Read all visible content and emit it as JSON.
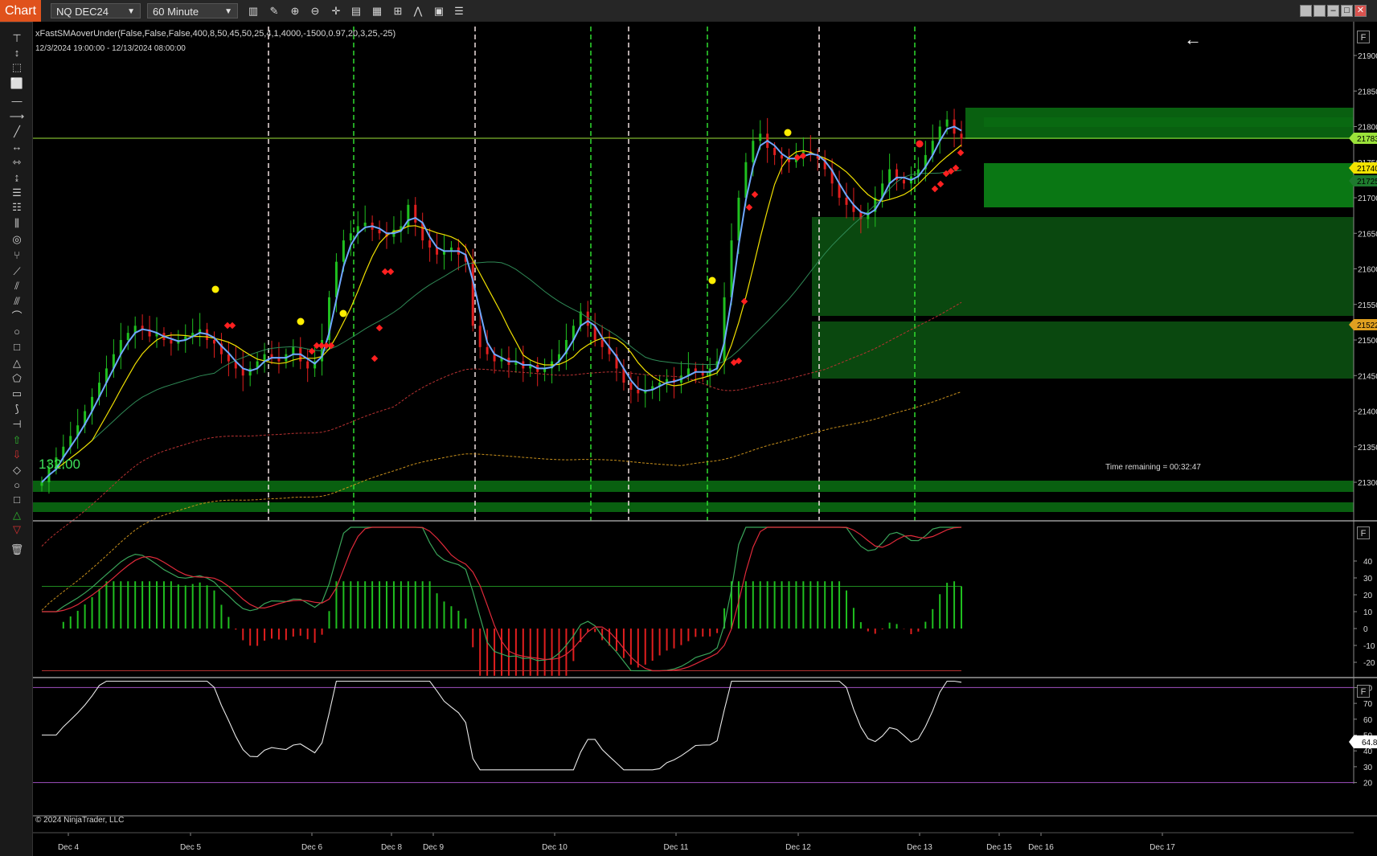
{
  "toolbar": {
    "chart_tab": "Chart",
    "instrument": "NQ DEC24",
    "interval": "60 Minute",
    "icons": [
      "bar-type-icon",
      "draw-tool-icon",
      "zoom-in-icon",
      "zoom-out-icon",
      "crosshair-icon",
      "data-box-icon",
      "properties-icon",
      "indicators-icon",
      "strategies-icon",
      "more-icon"
    ]
  },
  "window_controls": [
    "tile-icon",
    "tile2-icon",
    "minimize-icon",
    "maximize-icon",
    "close-icon"
  ],
  "left_tools": [
    "ruler-icon",
    "arrow-icon",
    "select-icon",
    "rectangle-select-icon",
    "line-icon",
    "ray-icon",
    "extended-line-icon",
    "arrow-line-icon",
    "horizontal-line-icon",
    "vertical-line-icon",
    "fib-retracement-icon",
    "fib-extension-icon",
    "fib-time-icon",
    "fib-circle-icon",
    "andrews-pitchfork-icon",
    "gann-fan-icon",
    "regression-channel-icon",
    "trend-channel-icon",
    "arc-icon",
    "ellipse-icon",
    "rectangle-icon",
    "triangle-icon",
    "polygon-icon",
    "region-icon",
    "path-icon",
    "risk-reward-icon",
    "arrow-up-icon",
    "arrow-down-icon",
    "diamond-icon",
    "dot-icon",
    "square-icon",
    "triangle-up-icon",
    "triangle-down-icon",
    "trash-icon"
  ],
  "header": {
    "indicator": "xFastSMAoverUnder(False,False,False,400,8,50,45,50,25,4,1,4000,-1500,0.97,20,3,25,-25)",
    "date_range": "12/3/2024 19:00:00 - 12/13/2024 08:00:00"
  },
  "main_panel": {
    "corner_value": "132.00",
    "time_remaining": "Time remaining = 00:32:47",
    "price_axis": [
      "21900.00",
      "21850.00",
      "21800.00",
      "21750.00",
      "21700.00",
      "21650.00",
      "21600.00",
      "21550.00",
      "21500.00",
      "21450.00",
      "21400.00",
      "21350.00",
      "21300.00"
    ],
    "price_markers": [
      {
        "label": "21783.25",
        "color": "#9be23a"
      },
      {
        "label": "21740.03",
        "color": "#f2e200"
      },
      {
        "label": "21725.10",
        "color": "#1e7a2e"
      },
      {
        "label": "21522.57",
        "color": "#e0a020"
      }
    ],
    "back_arrow": "←"
  },
  "macd_panel": {
    "axis": [
      "40",
      "30",
      "20",
      "10",
      "0",
      "-10",
      "-20"
    ]
  },
  "rsi_panel": {
    "axis": [
      "80",
      "70",
      "60",
      "50",
      "40",
      "30",
      "20"
    ],
    "value": "64.8"
  },
  "time_axis": [
    "Dec 4",
    "Dec 5",
    "Dec 6",
    "Dec 8",
    "Dec 9",
    "Dec 10",
    "Dec 11",
    "Dec 12",
    "Dec 13",
    "Dec 15",
    "Dec 16",
    "Dec 17"
  ],
  "footer": "© 2024 NinjaTrader, LLC",
  "colors": {
    "background": "#000000",
    "up_bar": "#1fbf1f",
    "down_bar": "#e01e1e",
    "fast_ma": "#6fa8ff",
    "slow_ma": "#f0e000",
    "zone": "#0d5a13"
  }
}
